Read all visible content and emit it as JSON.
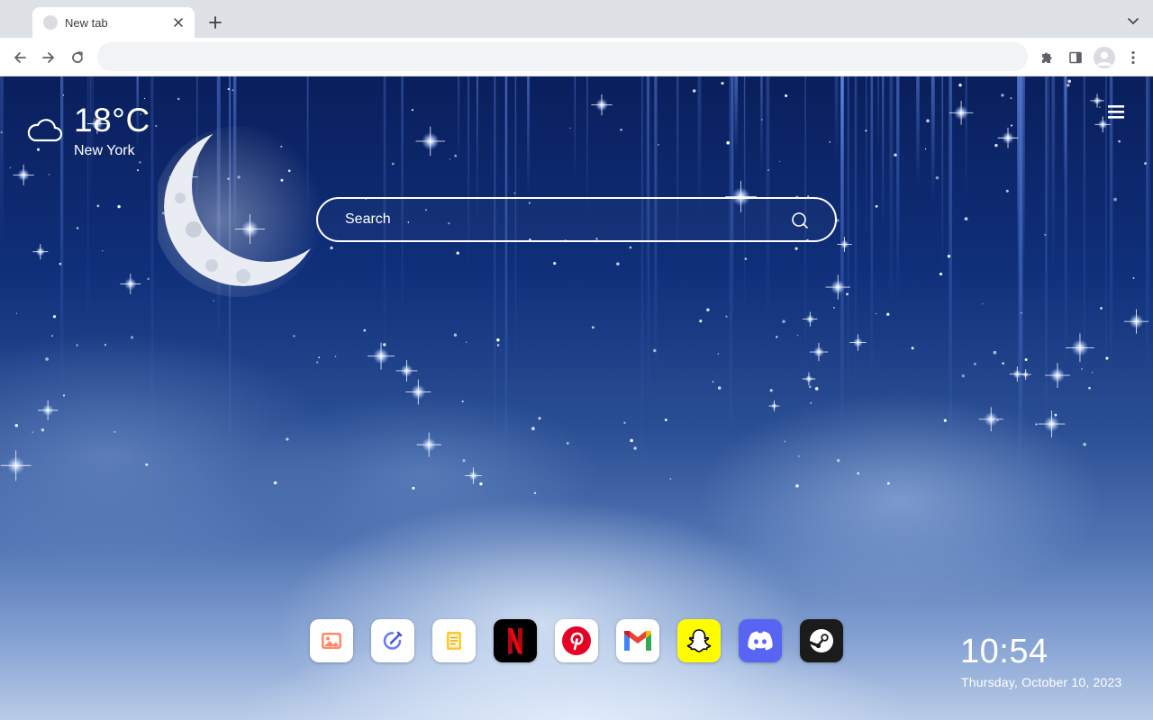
{
  "browser": {
    "tab": {
      "title": "New tab"
    },
    "omnibox": {
      "value": "",
      "placeholder": ""
    }
  },
  "weather": {
    "temperature": "18°C",
    "city": "New York",
    "icon": "cloud-icon"
  },
  "search": {
    "placeholder": "Search",
    "icon": "search-icon"
  },
  "shortcuts": [
    {
      "name": "Photos",
      "icon": "image-icon",
      "bg": "#ffffff"
    },
    {
      "name": "Edit",
      "icon": "edit-circle-icon",
      "bg": "#ffffff"
    },
    {
      "name": "Notes",
      "icon": "notes-icon",
      "bg": "#ffffff"
    },
    {
      "name": "Netflix",
      "icon": "netflix-icon",
      "bg": "#000000"
    },
    {
      "name": "Pinterest",
      "icon": "pinterest-icon",
      "bg": "#ffffff"
    },
    {
      "name": "Gmail",
      "icon": "gmail-icon",
      "bg": "#ffffff"
    },
    {
      "name": "Snapchat",
      "icon": "snapchat-icon",
      "bg": "#fffc00"
    },
    {
      "name": "Discord",
      "icon": "discord-icon",
      "bg": "#5865f2"
    },
    {
      "name": "Steam",
      "icon": "steam-icon",
      "bg": "#1b1b1b"
    }
  ],
  "clock": {
    "time": "10:54",
    "date": "Thursday, October 10, 2023"
  },
  "colors": {
    "sky_top": "#0a1f5c",
    "sky_bottom": "#b9cbe8",
    "chrome_bg": "#dee1e6"
  }
}
